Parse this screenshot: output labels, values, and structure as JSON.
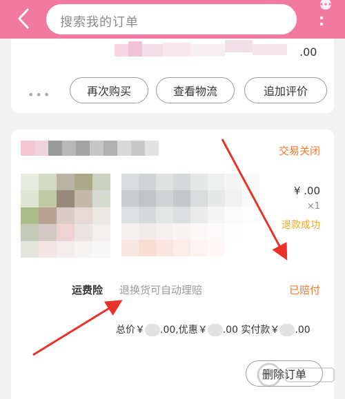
{
  "header": {
    "search_placeholder": "搜索我的订单",
    "bg_color": "#f27aa0"
  },
  "icons": [
    "chevron-left-icon",
    "more-vertical-icon",
    "ellipsis-icon"
  ],
  "previous_order": {
    "price_fragment": ".00",
    "more_label": "•••",
    "buttons": {
      "rebuy": "再次购买",
      "logistics": "查看物流",
      "review": "追加评价"
    }
  },
  "order": {
    "status": "交易关闭",
    "price": "¥ .00",
    "quantity": "×1",
    "refund_status": "退款成功",
    "insurance_label": "运费险",
    "insurance_desc": "退换货可自动理赔",
    "insurance_status": "已赔付",
    "totals": {
      "total_label": "总价￥",
      "total_value": ".00,优惠￥",
      "discount_value": ".00 实付款￥",
      "paid_value": ".00"
    },
    "delete_button": "删除订单"
  },
  "colors": {
    "accent_orange": "#f5782b",
    "refund_yellow": "#f5a623",
    "annotation_red": "#e8322b"
  }
}
